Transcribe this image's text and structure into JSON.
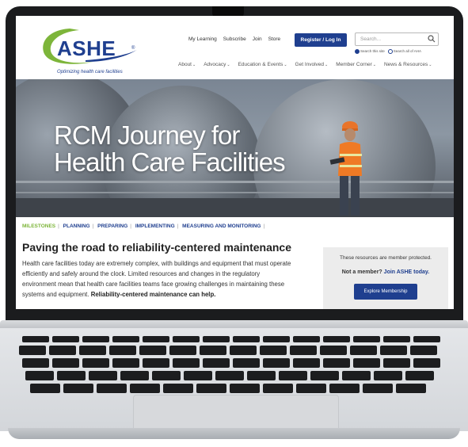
{
  "brand": {
    "logo_text": "ASHE",
    "tagline": "Optimizing health care facilities",
    "color_primary": "#1f3f8f",
    "color_accent": "#7db53a"
  },
  "header": {
    "top_links": [
      "My Learning",
      "Subscribe",
      "Join",
      "Store"
    ],
    "register_label": "Register / Log In",
    "search_placeholder": "Search...",
    "search_scope": {
      "option_site": "Search this site",
      "option_all": "Search all of AHA"
    },
    "nav": [
      "About",
      "Advocacy",
      "Education & Events",
      "Get Involved",
      "Member Corner",
      "News & Resources"
    ]
  },
  "hero": {
    "title_line1": "RCM Journey for",
    "title_line2": "Health Care Facilities"
  },
  "milestones": [
    "MILESTONES",
    "PLANNING",
    "PREPARING",
    "IMPLEMENTING",
    "MEASURING AND MONITORING"
  ],
  "content": {
    "heading": "Paving the road to reliability-centered maintenance",
    "body": "Health care facilities today are extremely complex, with buildings and equipment that must operate efficiently and safely around the clock. Limited resources and changes in the regulatory environment mean that health care facilities teams face growing challenges in maintaining these systems and equipment.",
    "body_bold": "Reliability-centered maintenance can help."
  },
  "aside": {
    "note": "These resources are member protected.",
    "cta_prefix": "Not a member?",
    "cta_link": "Join ASHE today.",
    "button": "Explore Membership"
  }
}
